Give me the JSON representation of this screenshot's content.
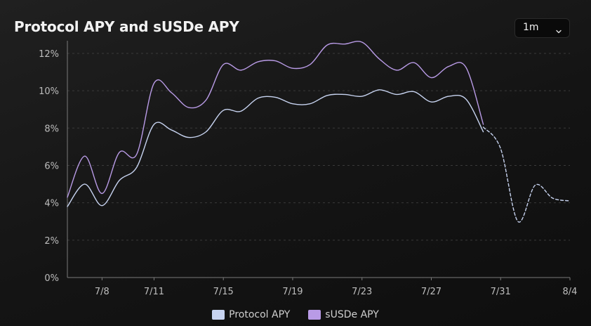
{
  "title": "Protocol APY and sUSDe APY",
  "range": {
    "value": "1m",
    "icon": "chevron-down-icon"
  },
  "legend": [
    {
      "label": "Protocol APY",
      "color": "#c7d3f0"
    },
    {
      "label": "sUSDe APY",
      "color": "#b99be6"
    }
  ],
  "chart_data": {
    "type": "line",
    "title": "Protocol APY and sUSDe APY",
    "xlabel": "",
    "ylabel": "",
    "x_tick_labels": [
      "7/8",
      "7/11",
      "7/15",
      "7/19",
      "7/23",
      "7/27",
      "7/31",
      "8/4"
    ],
    "y_tick_labels": [
      "0%",
      "2%",
      "4%",
      "6%",
      "8%",
      "10%",
      "12%"
    ],
    "ylim": [
      0,
      12.6
    ],
    "grid": true,
    "legend_position": "bottom",
    "series": [
      {
        "name": "Protocol APY",
        "color": "#c7d3f0",
        "points": [
          [
            "7/6",
            3.8
          ],
          [
            "7/7",
            5.0
          ],
          [
            "7/8",
            3.85
          ],
          [
            "7/9",
            5.2
          ],
          [
            "7/10",
            5.9
          ],
          [
            "7/11",
            8.2
          ],
          [
            "7/12",
            7.9
          ],
          [
            "7/13",
            7.5
          ],
          [
            "7/14",
            7.8
          ],
          [
            "7/15",
            8.95
          ],
          [
            "7/16",
            8.9
          ],
          [
            "7/17",
            9.6
          ],
          [
            "7/18",
            9.65
          ],
          [
            "7/19",
            9.3
          ],
          [
            "7/20",
            9.3
          ],
          [
            "7/21",
            9.75
          ],
          [
            "7/22",
            9.8
          ],
          [
            "7/23",
            9.7
          ],
          [
            "7/24",
            10.05
          ],
          [
            "7/25",
            9.8
          ],
          [
            "7/26",
            9.95
          ],
          [
            "7/27",
            9.4
          ],
          [
            "7/28",
            9.7
          ],
          [
            "7/29",
            9.55
          ],
          [
            "7/30",
            7.8
          ]
        ]
      },
      {
        "name": "sUSDe APY",
        "color": "#b99be6",
        "points": [
          [
            "7/6",
            4.3
          ],
          [
            "7/7",
            6.5
          ],
          [
            "7/8",
            4.5
          ],
          [
            "7/9",
            6.7
          ],
          [
            "7/10",
            6.6
          ],
          [
            "7/11",
            10.4
          ],
          [
            "7/12",
            9.9
          ],
          [
            "7/13",
            9.1
          ],
          [
            "7/14",
            9.5
          ],
          [
            "7/15",
            11.4
          ],
          [
            "7/16",
            11.1
          ],
          [
            "7/17",
            11.55
          ],
          [
            "7/18",
            11.6
          ],
          [
            "7/19",
            11.2
          ],
          [
            "7/20",
            11.4
          ],
          [
            "7/21",
            12.45
          ],
          [
            "7/22",
            12.5
          ],
          [
            "7/23",
            12.6
          ],
          [
            "7/24",
            11.7
          ],
          [
            "7/25",
            11.1
          ],
          [
            "7/26",
            11.5
          ],
          [
            "7/27",
            10.7
          ],
          [
            "7/28",
            11.3
          ],
          [
            "7/29",
            11.25
          ],
          [
            "7/30",
            8.2
          ]
        ]
      },
      {
        "name": "",
        "style": "dashed",
        "color": "#c7d3f0",
        "points": [
          [
            "7/30",
            8.05
          ],
          [
            "7/31",
            6.9
          ],
          [
            "8/1",
            3.0
          ],
          [
            "8/2",
            4.95
          ],
          [
            "8/3",
            4.25
          ],
          [
            "8/4",
            4.1
          ]
        ]
      }
    ]
  }
}
